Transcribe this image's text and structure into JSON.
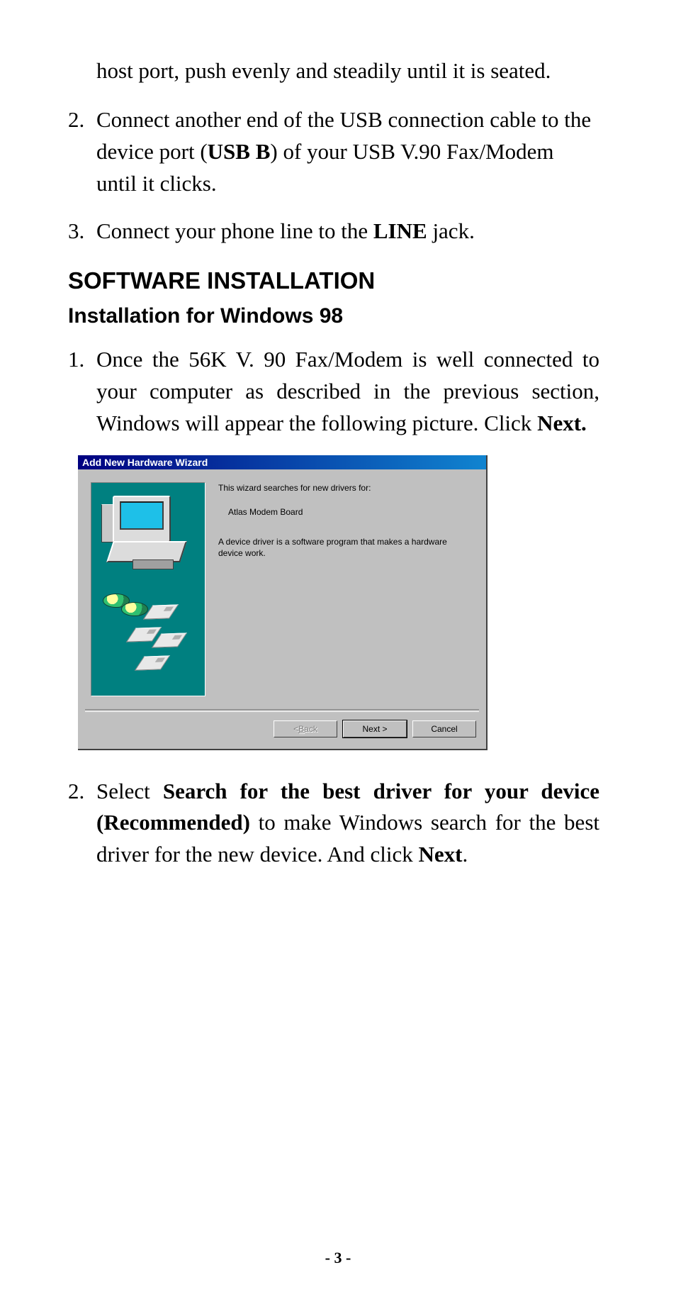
{
  "intro_continued": "host port, push evenly and steadily until it is seated.",
  "hw_steps": {
    "step2": {
      "num": "2.",
      "pre": "Connect another end of the USB connection cable to the device port (",
      "bold": "USB B",
      "post": ") of your USB V.90 Fax/Modem until it clicks."
    },
    "step3": {
      "num": "3.",
      "pre": "Connect your phone line to the ",
      "bold": "LINE",
      "post": " jack."
    }
  },
  "section_heading": "SOFTWARE INSTALLATION",
  "subsection_heading": "Installation for Windows 98",
  "sw_steps": {
    "step1": {
      "num": "1.",
      "pre": "Once the 56K V. 90 Fax/Modem is well connected to your computer as described in the previous section, Windows will appear the following picture.  Click ",
      "bold": "Next."
    },
    "step2": {
      "num": "2.",
      "pre": "Select ",
      "bold1": "Search for the best driver for your device (Recommended)",
      "mid": " to make Windows search for the best driver  for the new device. And click ",
      "bold2": "Next",
      "post": "."
    }
  },
  "wizard": {
    "title": "Add New Hardware Wizard",
    "line1": "This wizard searches for new drivers for:",
    "device": "Atlas Modem Board",
    "line2": "A device driver is a software program that makes a hardware device work.",
    "buttons": {
      "back_letter": "B",
      "back_rest": "ack",
      "back_prefix": "< ",
      "next": "Next >",
      "cancel": "Cancel"
    }
  },
  "page_number": "- 3 -"
}
